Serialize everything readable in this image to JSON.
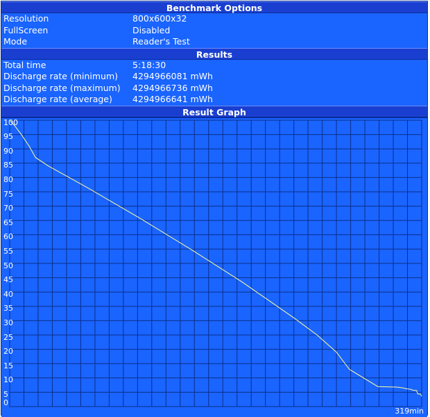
{
  "sections": {
    "options_title": "Benchmark Options",
    "results_title": "Results",
    "graph_title": "Result Graph"
  },
  "options": [
    {
      "label": "Resolution",
      "value": "800x600x32"
    },
    {
      "label": "FullScreen",
      "value": "Disabled"
    },
    {
      "label": "Mode",
      "value": "Reader's Test"
    }
  ],
  "results": [
    {
      "label": "Total time",
      "value": "5:18:30"
    },
    {
      "label": "Discharge rate (minimum)",
      "value": "4294966081 mWh"
    },
    {
      "label": "Discharge rate (maximum)",
      "value": "4294966736 mWh"
    },
    {
      "label": "Discharge rate (average)",
      "value": "4294966641 mWh"
    }
  ],
  "colors": {
    "panel": "#1a64ff",
    "header": "#1a3fd0",
    "grid": "#0a2f8a",
    "line": "#ffff9a"
  },
  "chart_data": {
    "type": "line",
    "title": "",
    "xlabel": "",
    "ylabel": "",
    "xlim": [
      0,
      319
    ],
    "ylim": [
      0,
      100
    ],
    "x_max_label": "319min",
    "y_ticks": [
      0,
      5,
      10,
      15,
      20,
      25,
      30,
      35,
      40,
      45,
      50,
      55,
      60,
      65,
      70,
      75,
      80,
      85,
      90,
      95,
      100
    ],
    "grid": true,
    "series": [
      {
        "x": [
          0,
          4,
          9,
          15,
          20,
          30,
          60,
          100,
          140,
          180,
          220,
          238,
          253,
          263,
          285,
          300,
          305,
          306,
          311,
          312,
          315,
          316,
          318,
          319
        ],
        "y": [
          100,
          98,
          95,
          91,
          87,
          84,
          76.5,
          66,
          55,
          43.5,
          31,
          25,
          19,
          13,
          7,
          6.8,
          6.5,
          6.3,
          6.0,
          5.7,
          5.6,
          4.4,
          4.4,
          3.6
        ]
      }
    ]
  }
}
